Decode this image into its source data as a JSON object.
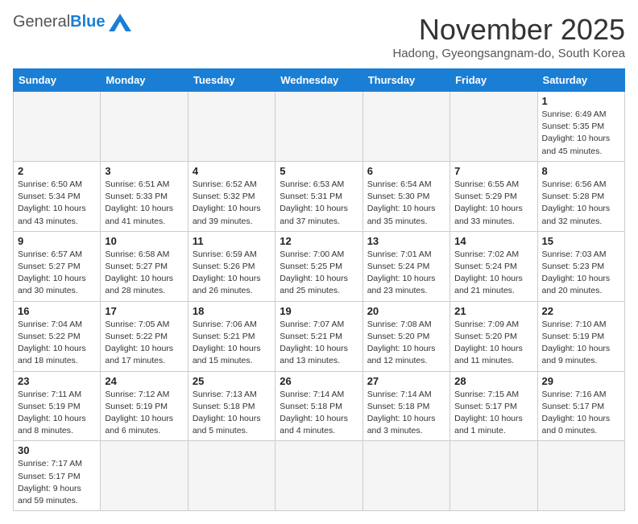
{
  "logo": {
    "general": "General",
    "blue": "Blue"
  },
  "title": {
    "month": "November 2025",
    "location": "Hadong, Gyeongsangnam-do, South Korea"
  },
  "weekdays": [
    "Sunday",
    "Monday",
    "Tuesday",
    "Wednesday",
    "Thursday",
    "Friday",
    "Saturday"
  ],
  "weeks": [
    [
      {
        "day": "",
        "info": ""
      },
      {
        "day": "",
        "info": ""
      },
      {
        "day": "",
        "info": ""
      },
      {
        "day": "",
        "info": ""
      },
      {
        "day": "",
        "info": ""
      },
      {
        "day": "",
        "info": ""
      },
      {
        "day": "1",
        "info": "Sunrise: 6:49 AM\nSunset: 5:35 PM\nDaylight: 10 hours\nand 45 minutes."
      }
    ],
    [
      {
        "day": "2",
        "info": "Sunrise: 6:50 AM\nSunset: 5:34 PM\nDaylight: 10 hours\nand 43 minutes."
      },
      {
        "day": "3",
        "info": "Sunrise: 6:51 AM\nSunset: 5:33 PM\nDaylight: 10 hours\nand 41 minutes."
      },
      {
        "day": "4",
        "info": "Sunrise: 6:52 AM\nSunset: 5:32 PM\nDaylight: 10 hours\nand 39 minutes."
      },
      {
        "day": "5",
        "info": "Sunrise: 6:53 AM\nSunset: 5:31 PM\nDaylight: 10 hours\nand 37 minutes."
      },
      {
        "day": "6",
        "info": "Sunrise: 6:54 AM\nSunset: 5:30 PM\nDaylight: 10 hours\nand 35 minutes."
      },
      {
        "day": "7",
        "info": "Sunrise: 6:55 AM\nSunset: 5:29 PM\nDaylight: 10 hours\nand 33 minutes."
      },
      {
        "day": "8",
        "info": "Sunrise: 6:56 AM\nSunset: 5:28 PM\nDaylight: 10 hours\nand 32 minutes."
      }
    ],
    [
      {
        "day": "9",
        "info": "Sunrise: 6:57 AM\nSunset: 5:27 PM\nDaylight: 10 hours\nand 30 minutes."
      },
      {
        "day": "10",
        "info": "Sunrise: 6:58 AM\nSunset: 5:27 PM\nDaylight: 10 hours\nand 28 minutes."
      },
      {
        "day": "11",
        "info": "Sunrise: 6:59 AM\nSunset: 5:26 PM\nDaylight: 10 hours\nand 26 minutes."
      },
      {
        "day": "12",
        "info": "Sunrise: 7:00 AM\nSunset: 5:25 PM\nDaylight: 10 hours\nand 25 minutes."
      },
      {
        "day": "13",
        "info": "Sunrise: 7:01 AM\nSunset: 5:24 PM\nDaylight: 10 hours\nand 23 minutes."
      },
      {
        "day": "14",
        "info": "Sunrise: 7:02 AM\nSunset: 5:24 PM\nDaylight: 10 hours\nand 21 minutes."
      },
      {
        "day": "15",
        "info": "Sunrise: 7:03 AM\nSunset: 5:23 PM\nDaylight: 10 hours\nand 20 minutes."
      }
    ],
    [
      {
        "day": "16",
        "info": "Sunrise: 7:04 AM\nSunset: 5:22 PM\nDaylight: 10 hours\nand 18 minutes."
      },
      {
        "day": "17",
        "info": "Sunrise: 7:05 AM\nSunset: 5:22 PM\nDaylight: 10 hours\nand 17 minutes."
      },
      {
        "day": "18",
        "info": "Sunrise: 7:06 AM\nSunset: 5:21 PM\nDaylight: 10 hours\nand 15 minutes."
      },
      {
        "day": "19",
        "info": "Sunrise: 7:07 AM\nSunset: 5:21 PM\nDaylight: 10 hours\nand 13 minutes."
      },
      {
        "day": "20",
        "info": "Sunrise: 7:08 AM\nSunset: 5:20 PM\nDaylight: 10 hours\nand 12 minutes."
      },
      {
        "day": "21",
        "info": "Sunrise: 7:09 AM\nSunset: 5:20 PM\nDaylight: 10 hours\nand 11 minutes."
      },
      {
        "day": "22",
        "info": "Sunrise: 7:10 AM\nSunset: 5:19 PM\nDaylight: 10 hours\nand 9 minutes."
      }
    ],
    [
      {
        "day": "23",
        "info": "Sunrise: 7:11 AM\nSunset: 5:19 PM\nDaylight: 10 hours\nand 8 minutes."
      },
      {
        "day": "24",
        "info": "Sunrise: 7:12 AM\nSunset: 5:19 PM\nDaylight: 10 hours\nand 6 minutes."
      },
      {
        "day": "25",
        "info": "Sunrise: 7:13 AM\nSunset: 5:18 PM\nDaylight: 10 hours\nand 5 minutes."
      },
      {
        "day": "26",
        "info": "Sunrise: 7:14 AM\nSunset: 5:18 PM\nDaylight: 10 hours\nand 4 minutes."
      },
      {
        "day": "27",
        "info": "Sunrise: 7:14 AM\nSunset: 5:18 PM\nDaylight: 10 hours\nand 3 minutes."
      },
      {
        "day": "28",
        "info": "Sunrise: 7:15 AM\nSunset: 5:17 PM\nDaylight: 10 hours\nand 1 minute."
      },
      {
        "day": "29",
        "info": "Sunrise: 7:16 AM\nSunset: 5:17 PM\nDaylight: 10 hours\nand 0 minutes."
      }
    ],
    [
      {
        "day": "30",
        "info": "Sunrise: 7:17 AM\nSunset: 5:17 PM\nDaylight: 9 hours\nand 59 minutes."
      },
      {
        "day": "",
        "info": ""
      },
      {
        "day": "",
        "info": ""
      },
      {
        "day": "",
        "info": ""
      },
      {
        "day": "",
        "info": ""
      },
      {
        "day": "",
        "info": ""
      },
      {
        "day": "",
        "info": ""
      }
    ]
  ]
}
